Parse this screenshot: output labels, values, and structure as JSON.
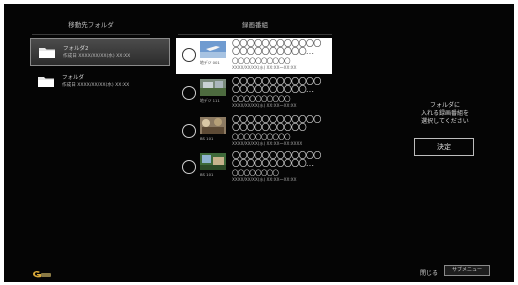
{
  "headers": {
    "destination_folder": "移動先フォルダ",
    "recordings": "録画番組"
  },
  "folders": [
    {
      "name": "フォルダ2",
      "created": "作成日 XXXX/XX/XX(水) XX:XX",
      "icon": "folder-icon",
      "selected": true
    },
    {
      "name": "フォルダ",
      "created": "作成日 XXXX/XX/XX(水) XX:XX",
      "icon": "folder-icon",
      "selected": false
    }
  ],
  "recordings": [
    {
      "title": "〇〇〇〇〇〇〇〇〇〇〇〇〇〇〇〇〇〇〇〇〇〇…",
      "subtitle": "〇〇〇〇〇〇〇〇〇〇",
      "channel": "地デジ 001",
      "datetime": "XXXX/XX/XX(水) XX:XX〜XX:XX",
      "selected": false,
      "highlighted": true
    },
    {
      "title": "〇〇〇〇〇〇〇〇〇〇〇〇〇〇〇〇〇〇〇〇〇〇…",
      "subtitle": "〇〇〇〇〇〇〇〇〇〇",
      "channel": "地デジ 111",
      "datetime": "XXXX/XX/XX(水) XX:XX〜XX:XX",
      "selected": false,
      "highlighted": false
    },
    {
      "title": "〇〇〇〇〇〇〇〇〇〇〇〇〇〇〇〇〇〇〇〇〇〇",
      "subtitle": "〇〇〇〇〇〇〇〇〇〇",
      "channel": "BS 101",
      "datetime": "XXXX/XX/XX(水) XX:XX〜XX:XXXX",
      "selected": false,
      "highlighted": false
    },
    {
      "title": "〇〇〇〇〇〇〇〇〇〇〇〇〇〇〇〇〇〇〇〇〇〇…",
      "subtitle": "〇〇〇〇〇〇〇〇",
      "channel": "BS 101",
      "datetime": "XXXX/XX/XX(水) XX:XX〜XX:XX",
      "selected": false,
      "highlighted": false
    }
  ],
  "instruction": {
    "line1": "フォルダに",
    "line2": "入れる録画番組を",
    "line3": "選択してください"
  },
  "ok_button": {
    "label": "決定"
  },
  "footer": {
    "close_label": "閉じる",
    "submenu_label": "サブメニュー"
  },
  "colors": {
    "background": "#050505",
    "highlight": "#ffffff",
    "folder_selected": "#3c3c3c"
  }
}
